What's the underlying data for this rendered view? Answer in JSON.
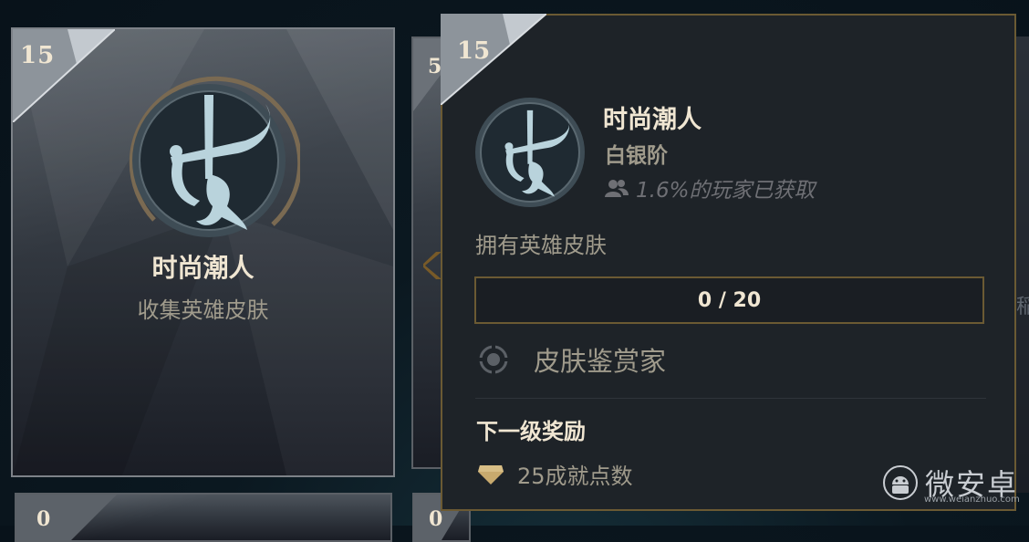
{
  "main_card": {
    "level": "15",
    "title": "时尚潮人",
    "subtitle": "收集英雄皮肤",
    "emblem_icon": "skin-collector-emblem-icon"
  },
  "behind_card": {
    "level": "5"
  },
  "bottom_cards": [
    {
      "level": "0"
    },
    {
      "level": "0"
    }
  ],
  "right_edge_text": "稲",
  "tooltip": {
    "level": "15",
    "name": "时尚潮人",
    "tier": "白银阶",
    "percent_text": "1.6%的玩家已获取",
    "description": "拥有英雄皮肤",
    "progress": {
      "current": 0,
      "total": 20,
      "text": "0 / 20"
    },
    "title_reward": "皮肤鉴赏家",
    "next_reward_heading": "下一级奖励",
    "reward_text": "25成就点数",
    "icons": {
      "players": "players-icon",
      "title": "title-target-icon",
      "reward": "gem-icon"
    }
  },
  "watermark": {
    "logo": "微安卓",
    "url": "www.weianzhuo.com"
  },
  "colors": {
    "gold": "#c8aa6e",
    "gold_dark": "#6b5a33",
    "text_light": "#f0e6d2",
    "text_muted": "#a09b8c",
    "panel_bg": "#1e2328"
  }
}
